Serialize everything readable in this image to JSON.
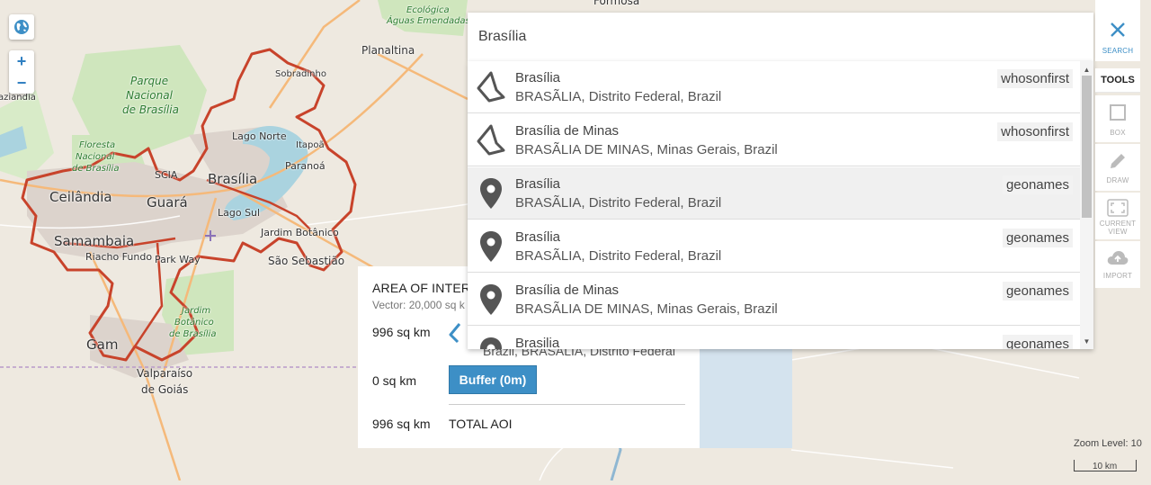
{
  "map": {
    "labels": {
      "formosa": "Formosa",
      "ecologica": "Ecológica",
      "aguas_emendadas": "Águas Emendadas",
      "planaltina": "Planaltina",
      "parque": "Parque",
      "nacional": "Nacional",
      "de_brasilia": "de Brasília",
      "floresta": "Floresta",
      "floresta_nacional": "Nacional",
      "floresta_de_brasilia": "de Brasília",
      "sobradinho": "Sobradinho",
      "lago_norte": "Lago Norte",
      "itapoa": "Itapoã",
      "paranoa": "Paranoá",
      "brasilia": "Brasília",
      "scia": "SCIA",
      "guara": "Guará",
      "ceilandia": "Ceilândia",
      "lago_sul": "Lago Sul",
      "jardim_botanico": "Jardim Botânico",
      "samambaia": "Samambaia",
      "riacho_fundo": "Riacho Fundo",
      "park_way": "Park Way",
      "sao_sebastiao": "São Sebastião",
      "jardim": "Jardim",
      "botanico": "Botânico",
      "de_brasilia2": "de Brasília",
      "gama": "Gam",
      "valparaiso": "Valparaíso",
      "de_goias": "de Goiás",
      "aziandia": "aziandia"
    },
    "zoom_in": "+",
    "zoom_out": "−",
    "zoom_level": "Zoom Level: 10",
    "scale": "10 km"
  },
  "aoi": {
    "title": "AREA OF INTER",
    "subtitle": "Vector: 20,000 sq k",
    "drawn_value": "996 sq km",
    "buffer_value": "0 sq km",
    "buffer_button": "Buffer (0m)",
    "total_value": "996 sq km",
    "total_label": "TOTAL AOI",
    "behind_text": "Brazil, BRASÃLIA, Distrito Federal"
  },
  "search": {
    "value": "Brasília",
    "results": [
      {
        "name": "Brasília",
        "address": "BRASÃLIA, Distrito Federal, Brazil",
        "source": "whosonfirst",
        "icon": "polygon-icon"
      },
      {
        "name": "Brasília de Minas",
        "address": "BRASÃLIA DE MINAS, Minas Gerais, Brazil",
        "source": "whosonfirst",
        "icon": "polygon-icon"
      },
      {
        "name": "Brasília",
        "address": "BRASÃLIA, Distrito Federal, Brazil",
        "source": "geonames",
        "icon": "map-pin-icon"
      },
      {
        "name": "Brasília",
        "address": "BRASÃLIA, Distrito Federal, Brazil",
        "source": "geonames",
        "icon": "map-pin-icon"
      },
      {
        "name": "Brasília de Minas",
        "address": "BRASÃLIA DE MINAS, Minas Gerais, Brazil",
        "source": "geonames",
        "icon": "map-pin-icon"
      },
      {
        "name": "Brasilia",
        "address": "",
        "source": "geonames",
        "icon": "map-pin-icon"
      }
    ]
  },
  "toolbar": {
    "search_label": "SEARCH",
    "tools_header": "TOOLS",
    "box_label": "BOX",
    "draw_label": "DRAW",
    "view_label_1": "CURRENT",
    "view_label_2": "VIEW",
    "import_label": "IMPORT"
  },
  "colors": {
    "accent": "#3d8fc6",
    "aoi_outline": "#c8432b",
    "water": "#aad3df",
    "urban": "#d9d0c9",
    "park": "#c8e6b3"
  }
}
